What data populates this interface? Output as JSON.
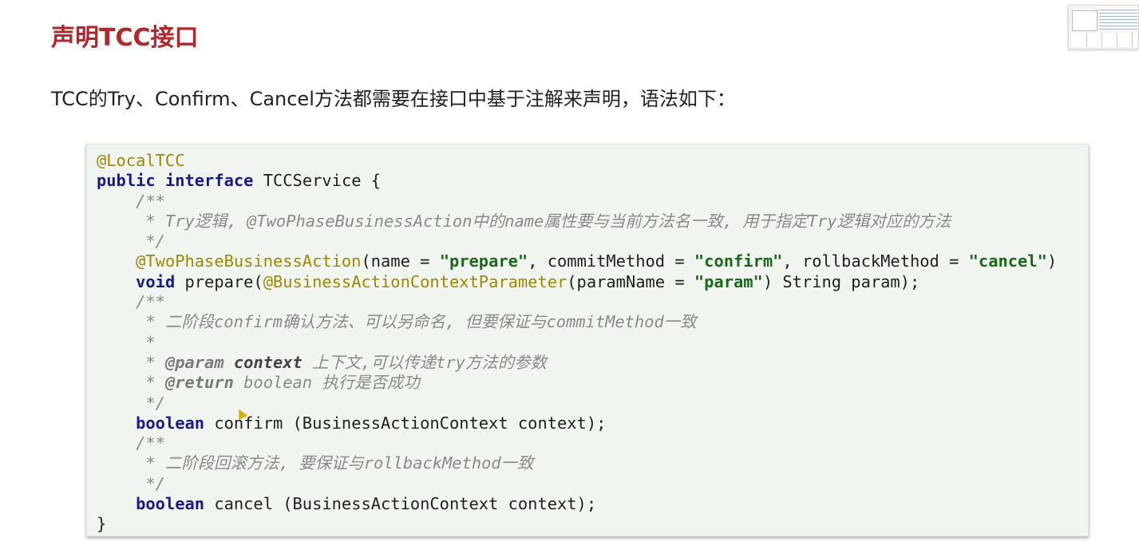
{
  "slide": {
    "title": "声明TCC接口",
    "description": "TCC的Try、Confirm、Cancel方法都需要在接口中基于注解来声明，语法如下："
  },
  "code": {
    "l1_annotation": "@LocalTCC",
    "l2_kw1": "public",
    "l2_kw2": "interface",
    "l2_rest": " TCCService {",
    "l3_comment": "    /**",
    "l4_comment": "     * Try逻辑, @TwoPhaseBusinessAction中的name属性要与当前方法名一致, 用于指定Try逻辑对应的方法",
    "l5_comment": "     */",
    "l6_indent": "    ",
    "l6_annotation": "@TwoPhaseBusinessAction",
    "l6_p1": "(name = ",
    "l6_s1": "\"prepare\"",
    "l6_p2": ", commitMethod = ",
    "l6_s2": "\"confirm\"",
    "l6_p3": ", rollbackMethod = ",
    "l6_s3": "\"cancel\"",
    "l6_p4": ")",
    "l7_indent": "    ",
    "l7_kw": "void",
    "l7_p1": " prepare(",
    "l7_annotation": "@BusinessActionContextParameter",
    "l7_p2": "(paramName = ",
    "l7_s1": "\"param\"",
    "l7_p3": ") String param);",
    "l8_comment": "    /**",
    "l9_comment": "     * 二阶段confirm确认方法、可以另命名, 但要保证与commitMethod一致",
    "l10_comment": "     *",
    "l11_c1": "     * ",
    "l11_tag": "@param",
    "l11_c2": " ",
    "l11_name": "context",
    "l11_c3": " 上下文,可以传递try方法的参数",
    "l12_c1": "     * ",
    "l12_tag": "@return",
    "l12_c2": " boolean 执行是否成功",
    "l13_comment": "     */",
    "l14_indent": "    ",
    "l14_kw": "boolean",
    "l14_rest": " confirm (BusinessActionContext context);",
    "l15_comment": "    /**",
    "l16_comment": "     * 二阶段回滚方法, 要保证与rollbackMethod一致",
    "l17_comment": "     */",
    "l18_indent": "    ",
    "l18_kw": "boolean",
    "l18_rest": " cancel (BusinessActionContext context);",
    "l19": "}"
  },
  "colors": {
    "title": "#b0272d",
    "code_background": "#f1f5ef",
    "keyword": "#1a1a8c",
    "annotation": "#9e8800",
    "string": "#1b6a1b",
    "comment": "#8a8a8a"
  },
  "icons": {
    "thumbnail": "slide-thumbnail-preview",
    "cursor": "mouse-pointer-icon"
  }
}
